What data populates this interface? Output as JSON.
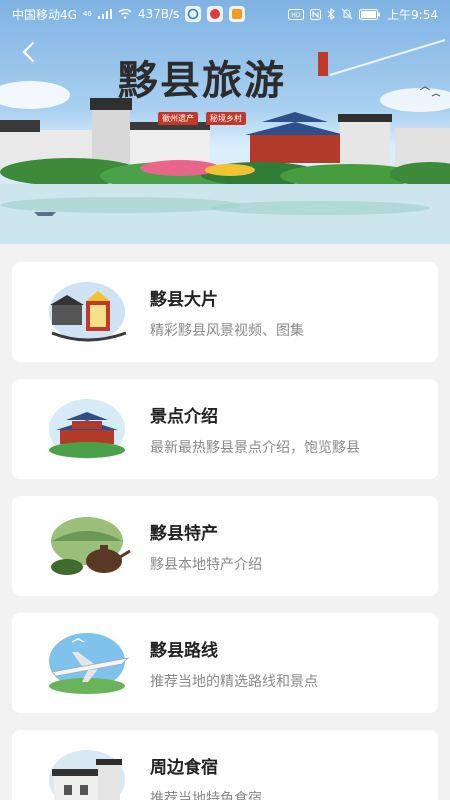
{
  "status_bar": {
    "carrier": "中国移动4G",
    "signal_superscript": "46",
    "network_speed": "437B/s",
    "time": "上午9:54"
  },
  "header": {
    "title": "黟县旅游",
    "tags": [
      "徽州遗产",
      "秘境乡村"
    ]
  },
  "icons": {
    "back": "chevron-left-icon"
  },
  "items": [
    {
      "title": "黟县大片",
      "desc": "精彩黟县风景视频、图集",
      "thumb": "video-theater-thumbnail"
    },
    {
      "title": "景点介绍",
      "desc": "最新最热黟县景点介绍，饱览黟县",
      "thumb": "pavilion-thumbnail"
    },
    {
      "title": "黟县特产",
      "desc": "黟县本地特产介绍",
      "thumb": "tea-teapot-thumbnail"
    },
    {
      "title": "黟县路线",
      "desc": "推荐当地的精选路线和景点",
      "thumb": "airplane-thumbnail"
    },
    {
      "title": "周边食宿",
      "desc": "推荐当地特色食宿",
      "thumb": "village-house-thumbnail"
    }
  ],
  "colors": {
    "card_bg": "#ffffff",
    "page_bg": "#f2f2f2",
    "title_color": "#222222",
    "desc_color": "#8a8a8a",
    "seal_red": "#c0392b"
  }
}
